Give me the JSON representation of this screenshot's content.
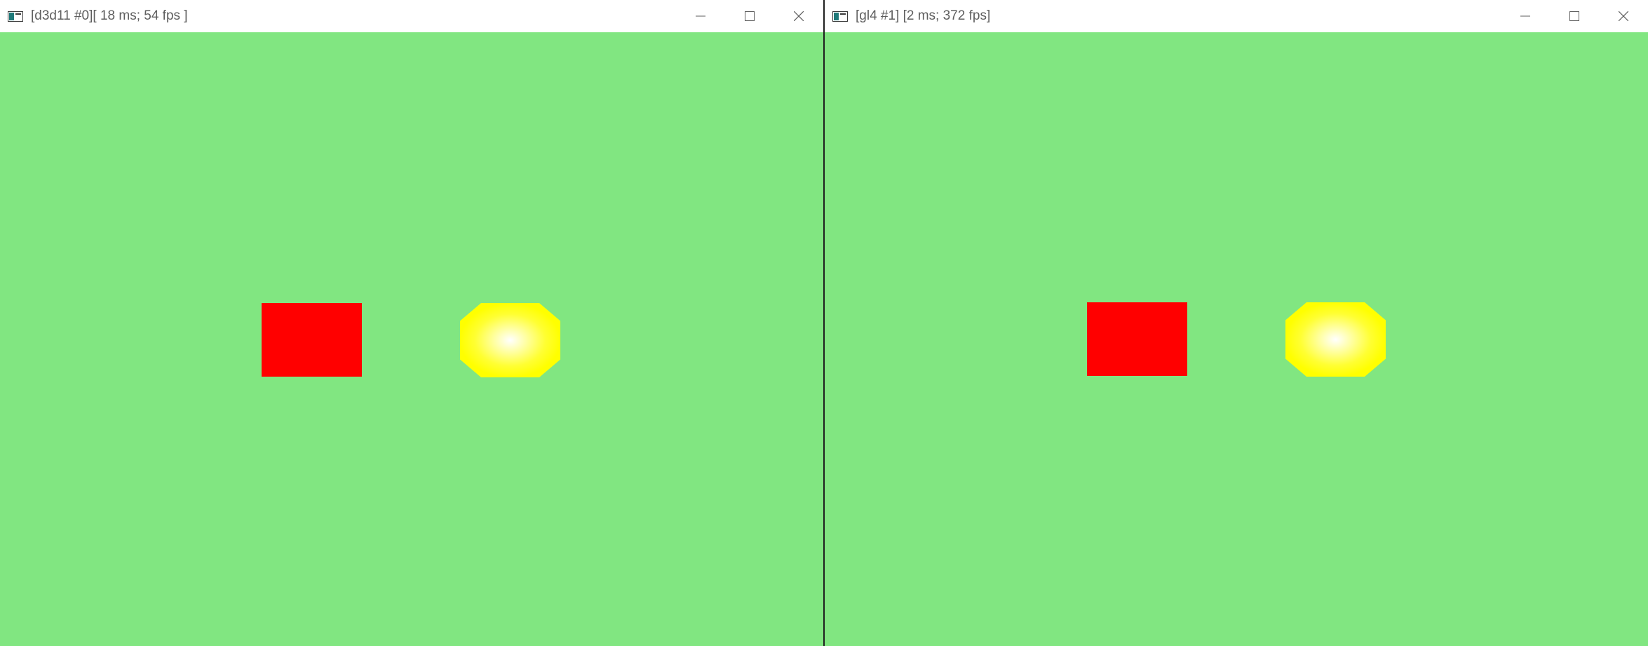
{
  "windows": [
    {
      "title": "[d3d11 #0][ 18 ms; 54 fps ]",
      "icon": "app-window-icon",
      "buttons": [
        "minimize-icon",
        "maximize-icon",
        "close-icon"
      ],
      "background_color": "#81e681",
      "shapes": [
        {
          "kind": "rectangle",
          "color": "#ff0000"
        },
        {
          "kind": "octagon",
          "color": "#ffff00",
          "gradient_center": "#ffffff"
        }
      ]
    },
    {
      "title": "[gl4 #1] [2 ms; 372 fps]",
      "icon": "app-window-icon",
      "buttons": [
        "minimize-icon",
        "maximize-icon",
        "close-icon"
      ],
      "background_color": "#81e681",
      "shapes": [
        {
          "kind": "rectangle",
          "color": "#ff0000"
        },
        {
          "kind": "octagon",
          "color": "#ffff00",
          "gradient_center": "#ffffff"
        }
      ]
    }
  ]
}
